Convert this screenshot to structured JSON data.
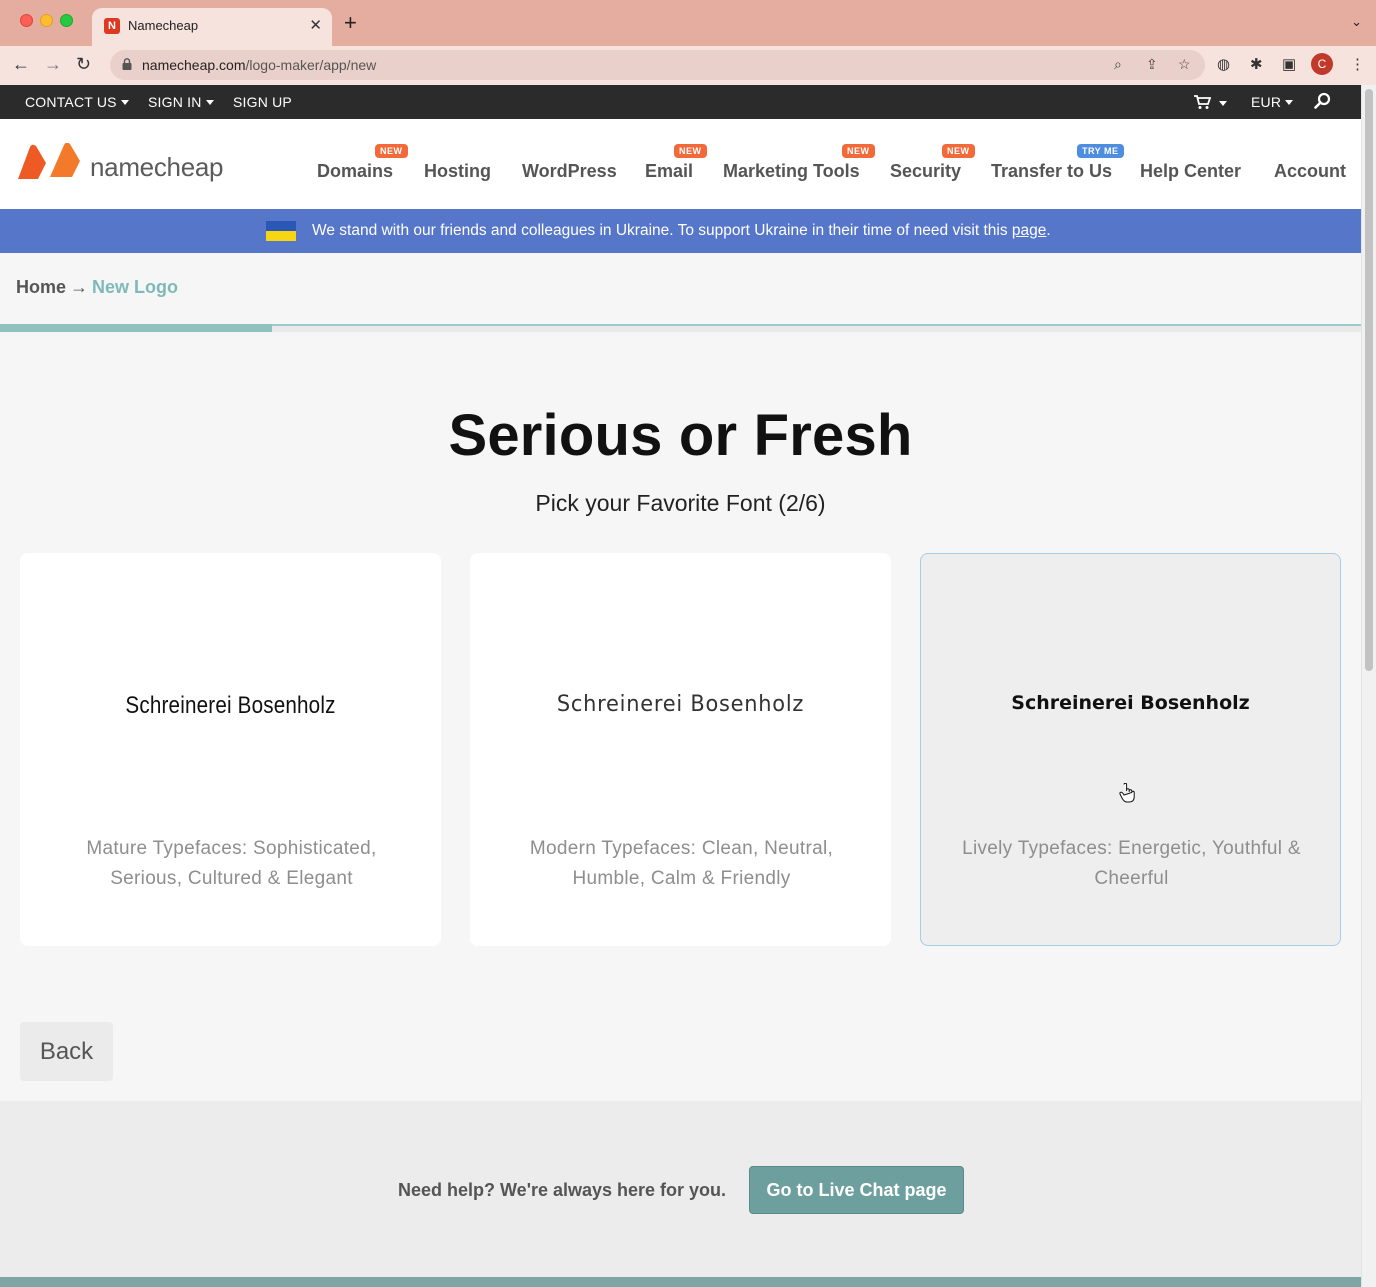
{
  "browser": {
    "tab_title": "Namecheap",
    "url_host": "namecheap.com",
    "url_path": "/logo-maker/app/new",
    "profile_initial": "C"
  },
  "topbar": {
    "contact": "CONTACT US",
    "signin": "SIGN IN",
    "signup": "SIGN UP",
    "currency": "EUR"
  },
  "header": {
    "logo_text": "namecheap",
    "nav": [
      {
        "label": "Domains",
        "badge": "NEW"
      },
      {
        "label": "Hosting",
        "badge": ""
      },
      {
        "label": "WordPress",
        "badge": ""
      },
      {
        "label": "Email",
        "badge": "NEW"
      },
      {
        "label": "Marketing Tools",
        "badge": "NEW"
      },
      {
        "label": "Security",
        "badge": "NEW"
      },
      {
        "label": "Transfer to Us",
        "badge": "TRY ME"
      },
      {
        "label": "Help Center",
        "badge": ""
      },
      {
        "label": "Account",
        "badge": ""
      }
    ]
  },
  "banner": {
    "text": "We stand with our friends and colleagues in Ukraine. To support Ukraine in their time of need visit this ",
    "link": "page",
    "end": "."
  },
  "breadcrumb": {
    "home": "Home",
    "arrow": "→",
    "current": "New Logo"
  },
  "progress": {
    "fraction": 0.2
  },
  "main": {
    "title": "Serious or Fresh",
    "subtitle": "Pick your Favorite Font (2/6)",
    "cards": [
      {
        "sample": "Schreinerei Bosenholz",
        "description": "Mature Typefaces: Sophisticated, Serious, Cultured & Elegant"
      },
      {
        "sample": "Schreinerei Bosenholz",
        "description": "Modern Typefaces: Clean, Neutral, Humble, Calm & Friendly"
      },
      {
        "sample": "Schreinerei Bosenholz",
        "description": "Lively Typefaces: Energetic, Youthful & Cheerful"
      }
    ],
    "back_label": "Back"
  },
  "help": {
    "text": "Need help? We're always here for you.",
    "button": "Go to Live Chat page"
  },
  "colors": {
    "accent": "#6e9f9f",
    "banner": "#5676c9",
    "brand_orange": "#f26a3a"
  }
}
